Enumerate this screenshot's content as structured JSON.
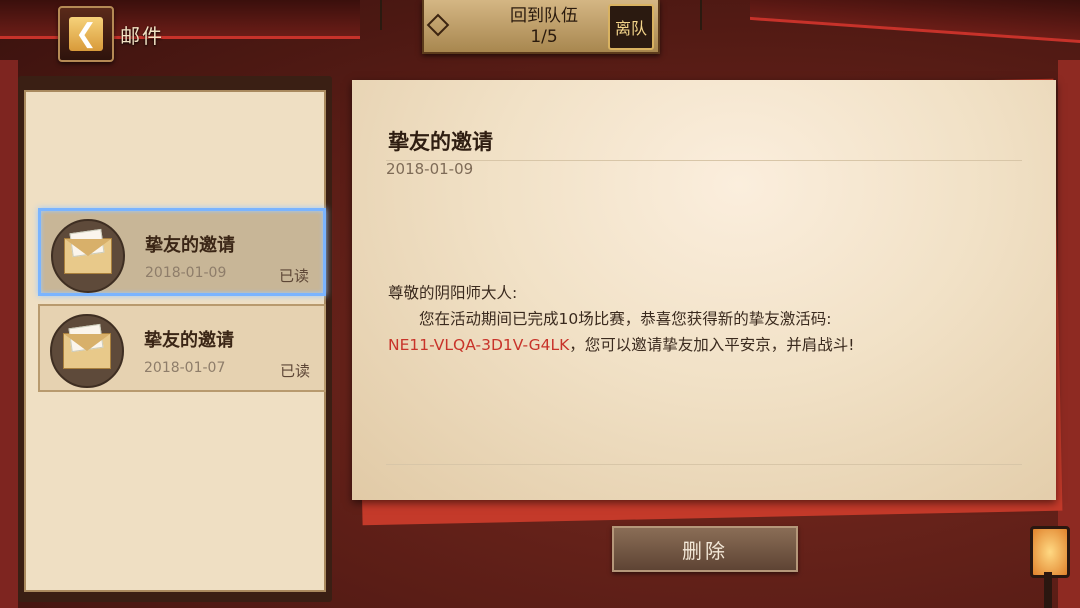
{
  "header": {
    "title": "邮件",
    "back_icon": "chevron-left-icon"
  },
  "team": {
    "line1": "回到队伍",
    "line2": "1/5",
    "leave_label": "离队"
  },
  "mail_list": [
    {
      "title": "挚友的邀请",
      "date": "2018-01-09",
      "status": "已读",
      "selected": true
    },
    {
      "title": "挚友的邀请",
      "date": "2018-01-07",
      "status": "已读",
      "selected": false
    }
  ],
  "letter": {
    "title": "挚友的邀请",
    "date": "2018-01-09",
    "greeting": "尊敬的阴阳师大人:",
    "body_line": "您在活动期间已完成10场比赛，恭喜您获得新的挚友激活码:",
    "code": "NE11-VLQA-3D1V-G4LK",
    "tail": "，您可以邀请挚友加入平安京，并肩战斗!"
  },
  "actions": {
    "delete_label": "删除"
  },
  "colors": {
    "code_red": "#c8332a",
    "selected_border": "#7ab4ff"
  }
}
